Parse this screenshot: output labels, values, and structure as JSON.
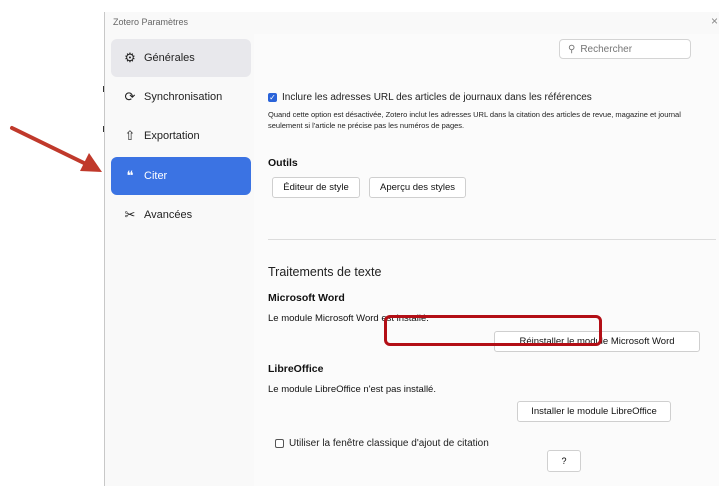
{
  "window": {
    "title": "Zotero Paramètres",
    "close": "×"
  },
  "sidebar": {
    "items": [
      {
        "label": "Générales",
        "icon": "gear-icon",
        "glyph": "⚙"
      },
      {
        "label": "Synchronisation",
        "icon": "sync-icon",
        "glyph": "⟳"
      },
      {
        "label": "Exportation",
        "icon": "export-icon",
        "glyph": "⇧"
      },
      {
        "label": "Citer",
        "icon": "cite-icon",
        "glyph": "❝"
      },
      {
        "label": "Avancées",
        "icon": "tools-icon",
        "glyph": "✂"
      }
    ]
  },
  "search": {
    "placeholder": "Rechercher",
    "glyph": "⚲"
  },
  "citation_options": {
    "include_urls_label": "Inclure les adresses URL des articles de journaux dans les références",
    "include_urls_checked": true,
    "description": "Quand cette option est désactivée, Zotero inclut les adresses URL dans la citation des articles de revue, magazine et journal seulement si l'article ne précise pas les numéros de pages."
  },
  "tools": {
    "heading": "Outils",
    "style_editor": "Éditeur de style",
    "style_preview": "Aperçu des styles"
  },
  "word_processors": {
    "heading": "Traitements de texte",
    "word": {
      "heading": "Microsoft Word",
      "status": "Le module Microsoft Word est installé.",
      "button": "Réinstaller le module Microsoft Word"
    },
    "libreoffice": {
      "heading": "LibreOffice",
      "status": "Le module LibreOffice n'est pas installé.",
      "button": "Installer le module LibreOffice"
    },
    "classic_dialog_label": "Utiliser la fenêtre classique d'ajout de citation",
    "classic_dialog_checked": false
  },
  "help": {
    "label": "?"
  },
  "colors": {
    "accent": "#3b73e3",
    "highlight_border": "#b30f16",
    "arrow": "#c0392b"
  }
}
